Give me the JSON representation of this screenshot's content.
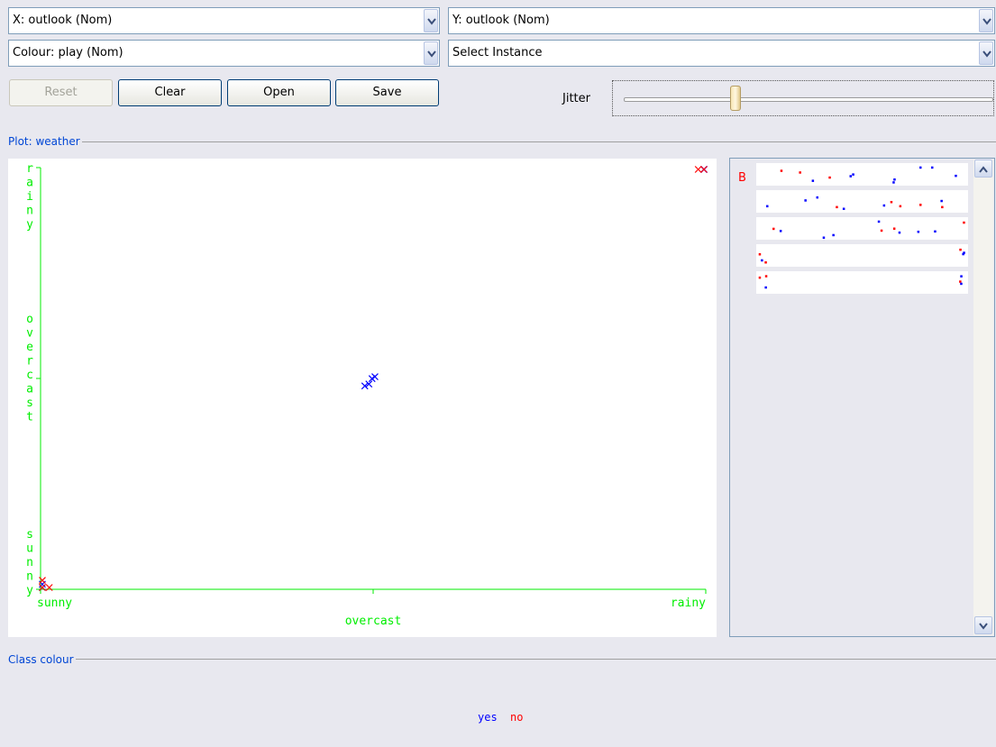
{
  "selectors": {
    "x_axis": "X: outlook (Nom)",
    "y_axis": "Y: outlook (Nom)",
    "colour": "Colour: play (Nom)",
    "instance": "Select Instance"
  },
  "buttons": {
    "reset": "Reset",
    "clear": "Clear",
    "open": "Open",
    "save": "Save"
  },
  "jitter": {
    "label": "Jitter",
    "value_fraction": 0.29
  },
  "plot": {
    "section_label": "Plot: weather",
    "x_categories": [
      "sunny",
      "overcast",
      "rainy"
    ],
    "y_categories": [
      "sunny",
      "overcast",
      "rainy"
    ],
    "x_axis_title": "overcast"
  },
  "chart_data": {
    "type": "scatter",
    "x_categories": [
      "sunny",
      "overcast",
      "rainy"
    ],
    "y_categories": [
      "sunny",
      "overcast",
      "rainy"
    ],
    "series": [
      {
        "name": "yes",
        "color": "#0000ff",
        "points": [
          {
            "x": "sunny",
            "y": "sunny"
          },
          {
            "x": "sunny",
            "y": "sunny"
          },
          {
            "x": "overcast",
            "y": "overcast"
          },
          {
            "x": "overcast",
            "y": "overcast"
          },
          {
            "x": "overcast",
            "y": "overcast"
          },
          {
            "x": "overcast",
            "y": "overcast"
          },
          {
            "x": "rainy",
            "y": "rainy"
          },
          {
            "x": "rainy",
            "y": "rainy"
          },
          {
            "x": "rainy",
            "y": "rainy"
          }
        ]
      },
      {
        "name": "no",
        "color": "#ff0000",
        "points": [
          {
            "x": "sunny",
            "y": "sunny"
          },
          {
            "x": "sunny",
            "y": "sunny"
          },
          {
            "x": "sunny",
            "y": "sunny"
          },
          {
            "x": "rainy",
            "y": "rainy"
          },
          {
            "x": "rainy",
            "y": "rainy"
          }
        ]
      }
    ]
  },
  "attribute_panel": {
    "marker_label": "B",
    "strip_count": 5
  },
  "class_colour": {
    "section_label": "Class colour",
    "classes": [
      {
        "label": "yes",
        "color": "#0000ff"
      },
      {
        "label": "no",
        "color": "#ff0000"
      }
    ]
  },
  "icons": {
    "dropdown": "chevron-down-icon",
    "scroll_up": "chevron-up-icon",
    "scroll_down": "chevron-down-icon"
  }
}
